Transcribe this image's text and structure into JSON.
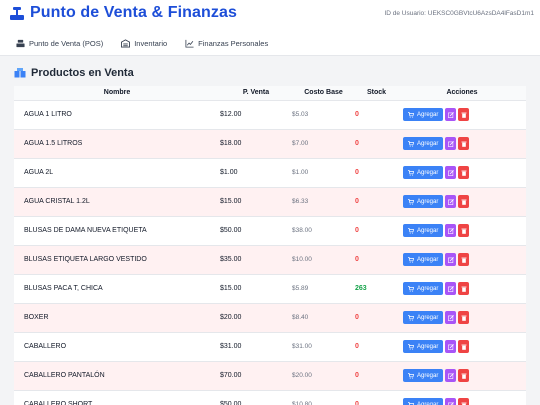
{
  "header": {
    "title": "Punto de Venta & Finanzas",
    "user_id": "ID de Usuario: UEKSC0GBVtcU6AzsDA4lFasD1m1"
  },
  "nav": {
    "items": [
      {
        "label": "Punto de Venta (POS)",
        "icon": "cash-register-icon"
      },
      {
        "label": "Inventario",
        "icon": "warehouse-icon"
      },
      {
        "label": "Finanzas Personales",
        "icon": "chart-line-icon"
      }
    ]
  },
  "section": {
    "title": "Productos en Venta",
    "icon": "boxes-icon"
  },
  "table": {
    "headers": [
      "Nombre",
      "P. Venta",
      "Costo Base",
      "Stock",
      "Acciones"
    ],
    "add_label": "Agregar",
    "rows": [
      {
        "name": "AGUA 1 LITRO",
        "price": "$12.00",
        "cost": "$5.03",
        "stock": "0"
      },
      {
        "name": "AGUA 1.5 LITROS",
        "price": "$18.00",
        "cost": "$7.00",
        "stock": "0"
      },
      {
        "name": "AGUA 2L",
        "price": "$1.00",
        "cost": "$1.00",
        "stock": "0"
      },
      {
        "name": "AGUA CRISTAL 1.2L",
        "price": "$15.00",
        "cost": "$6.33",
        "stock": "0"
      },
      {
        "name": "BLUSAS DE DAMA NUEVA ETIQUETA",
        "price": "$50.00",
        "cost": "$38.00",
        "stock": "0"
      },
      {
        "name": "BLUSAS ETIQUETA LARGO VESTIDO",
        "price": "$35.00",
        "cost": "$10.00",
        "stock": "0"
      },
      {
        "name": "BLUSAS PACA T, CHICA",
        "price": "$15.00",
        "cost": "$5.89",
        "stock": "263"
      },
      {
        "name": "BOXER",
        "price": "$20.00",
        "cost": "$8.40",
        "stock": "0"
      },
      {
        "name": "CABALLERO",
        "price": "$31.00",
        "cost": "$31.00",
        "stock": "0"
      },
      {
        "name": "CABALLERO PANTALÓN",
        "price": "$70.00",
        "cost": "$20.00",
        "stock": "0"
      },
      {
        "name": "CABALLERO SHORT",
        "price": "$50.00",
        "cost": "$10.80",
        "stock": "0"
      }
    ]
  },
  "colors": {
    "brand": "#1d4ed8",
    "add_button": "#3b82f6",
    "edit_button": "#a855f7",
    "delete_button": "#ef4444",
    "stock_zero": "#ef4444",
    "stock_positive": "#16a34a",
    "row_alt": "#fff1f2"
  }
}
